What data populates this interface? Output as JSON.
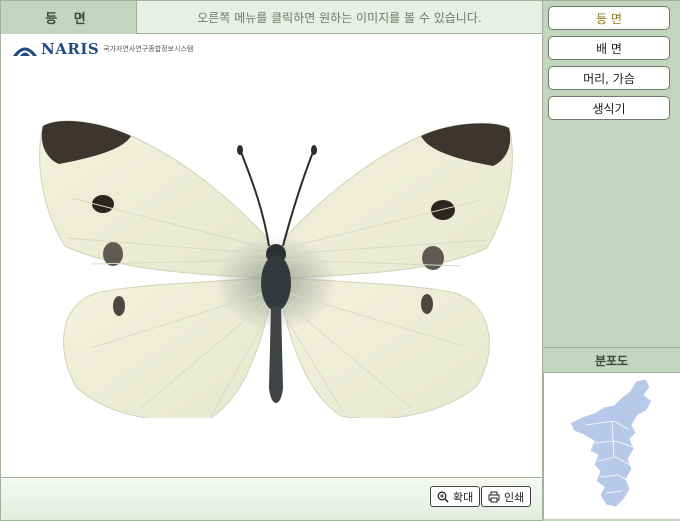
{
  "header": {
    "view_title": "등 면",
    "hint": "오른쪽 메뉴를 클릭하면 원하는 이미지를 볼 수 있습니다."
  },
  "logo": {
    "name": "NARIS",
    "subtitle": "국가자연사연구종합정보시스템"
  },
  "viewer": {
    "image": "butterfly-specimen"
  },
  "toolbar": {
    "zoom_label": "확대",
    "print_label": "인쇄"
  },
  "side_menu": {
    "items": [
      {
        "label": "등 면"
      },
      {
        "label": "배 면"
      },
      {
        "label": "머리, 가슴"
      },
      {
        "label": "생식기"
      }
    ],
    "active_color": "#8a7a1a"
  },
  "distribution": {
    "title": "분포도",
    "map": "korean-peninsula-map",
    "fill_color": "#b7c9e8"
  },
  "colors": {
    "panel_green": "#c3d5bd",
    "border_green": "#9fb39a"
  }
}
